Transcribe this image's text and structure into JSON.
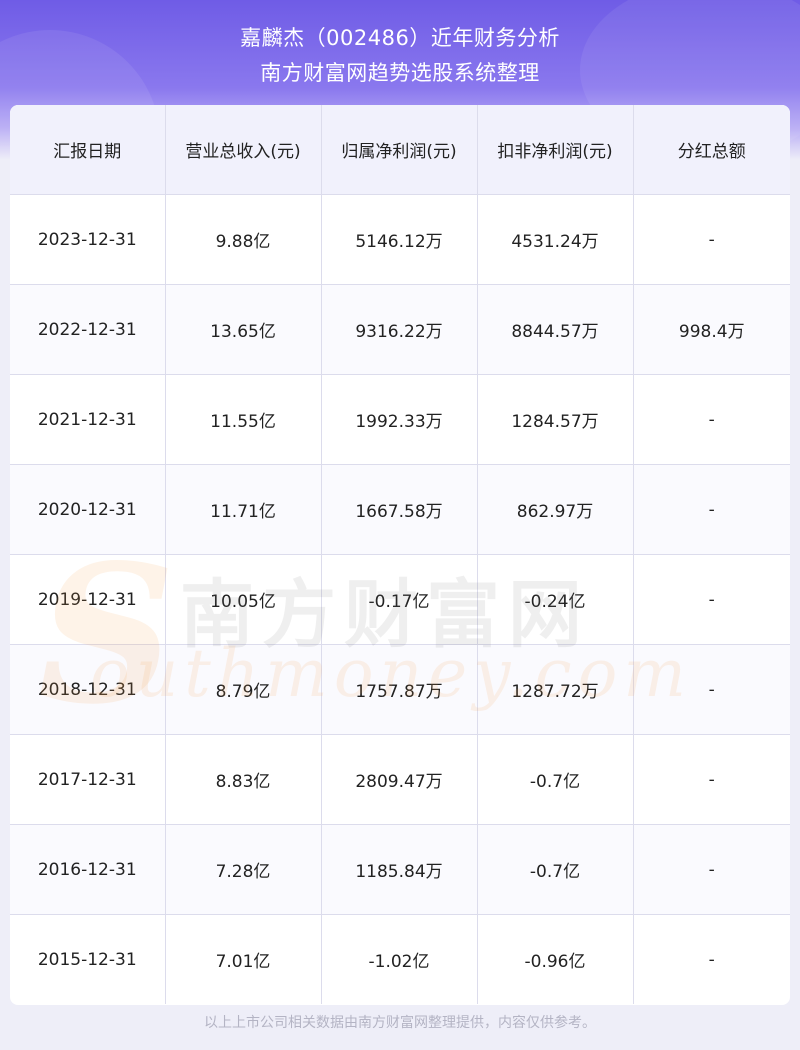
{
  "header": {
    "title_line1": "嘉麟杰（002486）近年财务分析",
    "title_line2": "南方财富网趋势选股系统整理"
  },
  "table": {
    "columns": [
      "汇报日期",
      "营业总收入(元)",
      "归属净利润(元)",
      "扣非净利润(元)",
      "分红总额"
    ],
    "rows": [
      [
        "2023-12-31",
        "9.88亿",
        "5146.12万",
        "4531.24万",
        "-"
      ],
      [
        "2022-12-31",
        "13.65亿",
        "9316.22万",
        "8844.57万",
        "998.4万"
      ],
      [
        "2021-12-31",
        "11.55亿",
        "1992.33万",
        "1284.57万",
        "-"
      ],
      [
        "2020-12-31",
        "11.71亿",
        "1667.58万",
        "862.97万",
        "-"
      ],
      [
        "2019-12-31",
        "10.05亿",
        "-0.17亿",
        "-0.24亿",
        "-"
      ],
      [
        "2018-12-31",
        "8.79亿",
        "1757.87万",
        "1287.72万",
        "-"
      ],
      [
        "2017-12-31",
        "8.83亿",
        "2809.47万",
        "-0.7亿",
        "-"
      ],
      [
        "2016-12-31",
        "7.28亿",
        "1185.84万",
        "-0.7亿",
        "-"
      ],
      [
        "2015-12-31",
        "7.01亿",
        "-1.02亿",
        "-0.96亿",
        "-"
      ]
    ]
  },
  "watermark": {
    "letter": "S",
    "cn": "南方财富网",
    "en": "outhmoney.com"
  },
  "footer": {
    "text": "以上上市公司相关数据由南方财富网整理提供，内容仅供参考。"
  }
}
